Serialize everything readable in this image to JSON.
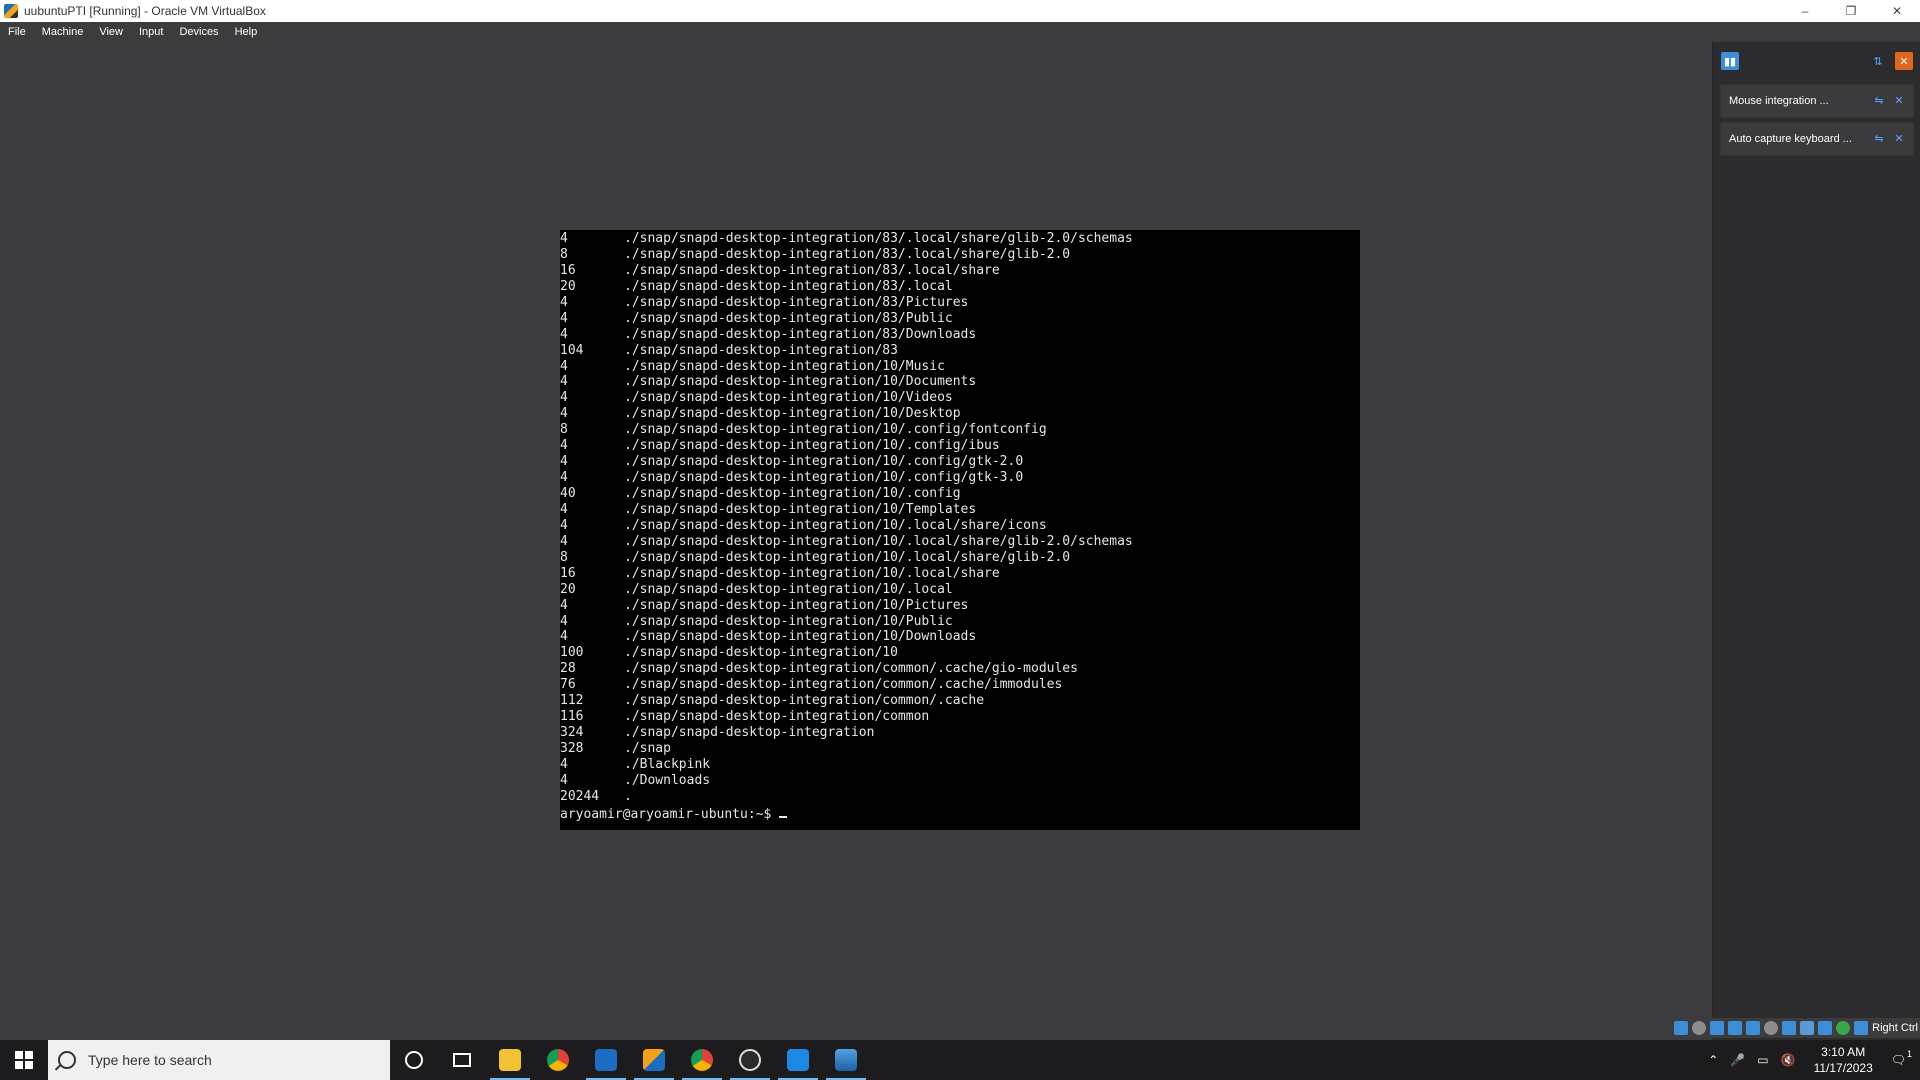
{
  "window": {
    "title": "uubuntuPTI [Running] - Oracle VM VirtualBox",
    "controls": {
      "minimize": "–",
      "restore": "❐",
      "close": "✕"
    }
  },
  "menubar": {
    "items": [
      "File",
      "Machine",
      "View",
      "Input",
      "Devices",
      "Help"
    ]
  },
  "terminal": {
    "lines": [
      {
        "size": "4",
        "path": "./snap/snapd-desktop-integration/83/.local/share/glib-2.0/schemas"
      },
      {
        "size": "8",
        "path": "./snap/snapd-desktop-integration/83/.local/share/glib-2.0"
      },
      {
        "size": "16",
        "path": "./snap/snapd-desktop-integration/83/.local/share"
      },
      {
        "size": "20",
        "path": "./snap/snapd-desktop-integration/83/.local"
      },
      {
        "size": "4",
        "path": "./snap/snapd-desktop-integration/83/Pictures"
      },
      {
        "size": "4",
        "path": "./snap/snapd-desktop-integration/83/Public"
      },
      {
        "size": "4",
        "path": "./snap/snapd-desktop-integration/83/Downloads"
      },
      {
        "size": "104",
        "path": "./snap/snapd-desktop-integration/83"
      },
      {
        "size": "4",
        "path": "./snap/snapd-desktop-integration/10/Music"
      },
      {
        "size": "4",
        "path": "./snap/snapd-desktop-integration/10/Documents"
      },
      {
        "size": "4",
        "path": "./snap/snapd-desktop-integration/10/Videos"
      },
      {
        "size": "4",
        "path": "./snap/snapd-desktop-integration/10/Desktop"
      },
      {
        "size": "8",
        "path": "./snap/snapd-desktop-integration/10/.config/fontconfig"
      },
      {
        "size": "4",
        "path": "./snap/snapd-desktop-integration/10/.config/ibus"
      },
      {
        "size": "4",
        "path": "./snap/snapd-desktop-integration/10/.config/gtk-2.0"
      },
      {
        "size": "4",
        "path": "./snap/snapd-desktop-integration/10/.config/gtk-3.0"
      },
      {
        "size": "40",
        "path": "./snap/snapd-desktop-integration/10/.config"
      },
      {
        "size": "4",
        "path": "./snap/snapd-desktop-integration/10/Templates"
      },
      {
        "size": "4",
        "path": "./snap/snapd-desktop-integration/10/.local/share/icons"
      },
      {
        "size": "4",
        "path": "./snap/snapd-desktop-integration/10/.local/share/glib-2.0/schemas"
      },
      {
        "size": "8",
        "path": "./snap/snapd-desktop-integration/10/.local/share/glib-2.0"
      },
      {
        "size": "16",
        "path": "./snap/snapd-desktop-integration/10/.local/share"
      },
      {
        "size": "20",
        "path": "./snap/snapd-desktop-integration/10/.local"
      },
      {
        "size": "4",
        "path": "./snap/snapd-desktop-integration/10/Pictures"
      },
      {
        "size": "4",
        "path": "./snap/snapd-desktop-integration/10/Public"
      },
      {
        "size": "4",
        "path": "./snap/snapd-desktop-integration/10/Downloads"
      },
      {
        "size": "100",
        "path": "./snap/snapd-desktop-integration/10"
      },
      {
        "size": "28",
        "path": "./snap/snapd-desktop-integration/common/.cache/gio-modules"
      },
      {
        "size": "76",
        "path": "./snap/snapd-desktop-integration/common/.cache/immodules"
      },
      {
        "size": "112",
        "path": "./snap/snapd-desktop-integration/common/.cache"
      },
      {
        "size": "116",
        "path": "./snap/snapd-desktop-integration/common"
      },
      {
        "size": "324",
        "path": "./snap/snapd-desktop-integration"
      },
      {
        "size": "328",
        "path": "./snap"
      },
      {
        "size": "4",
        "path": "./Blackpink"
      },
      {
        "size": "4",
        "path": "./Downloads"
      },
      {
        "size": "20244",
        "path": "."
      }
    ],
    "prompt": "aryoamir@aryoamir-ubuntu:~$ "
  },
  "notifications": {
    "items": [
      {
        "label": "Mouse integration ..."
      },
      {
        "label": "Auto capture keyboard ..."
      }
    ]
  },
  "status_tray": {
    "host_key": "Right Ctrl"
  },
  "taskbar": {
    "search_placeholder": "Type here to search",
    "time": "3:10 AM",
    "date": "11/17/2023",
    "notification_count": "1"
  },
  "colors": {
    "accent": "#76b9ed",
    "terminal_bg": "#000000",
    "vm_bg": "#3c3c3e"
  }
}
